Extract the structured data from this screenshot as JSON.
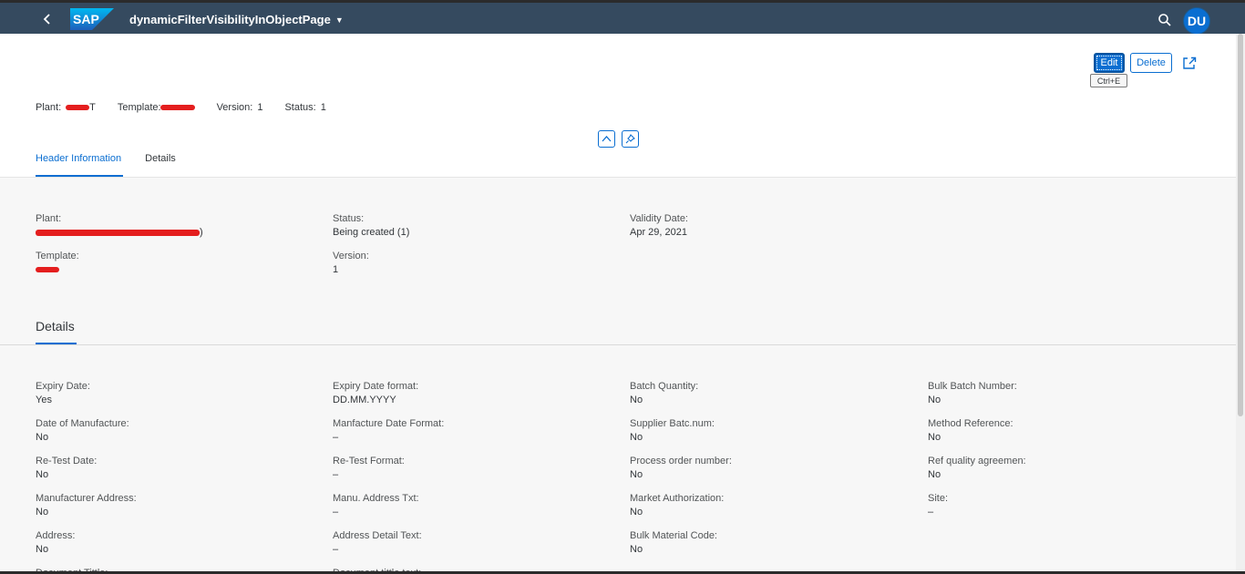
{
  "shell": {
    "title": "dynamicFilterVisibilityInObjectPage",
    "avatar_initials": "DU",
    "logo_text": "SAP"
  },
  "actions": {
    "edit_label": "Edit",
    "delete_label": "Delete",
    "edit_tooltip": "Ctrl+E"
  },
  "kpis": {
    "plant_label": "Plant:",
    "plant_suffix": "T",
    "template_label": "Template:",
    "version_label": "Version:",
    "version_value": "1",
    "status_label": "Status:",
    "status_value": "1"
  },
  "tabs": [
    {
      "label": "Header Information",
      "active": true
    },
    {
      "label": "Details",
      "active": false
    }
  ],
  "header_info": {
    "plant_label": "Plant:",
    "plant_suffix": ")",
    "template_label": "Template:",
    "status_label": "Status:",
    "status_value": "Being created (1)",
    "version_label": "Version:",
    "version_value": "1",
    "validity_label": "Validity Date:",
    "validity_value": "Apr 29, 2021"
  },
  "details": {
    "title": "Details",
    "columns": [
      [
        {
          "label": "Expiry Date:",
          "value": "Yes"
        },
        {
          "label": "Date of Manufacture:",
          "value": "No"
        },
        {
          "label": "Re-Test Date:",
          "value": "No"
        },
        {
          "label": "Manufacturer Address:",
          "value": "No"
        },
        {
          "label": "Address:",
          "value": "No"
        },
        {
          "label": "Document Tittle:",
          "value": ""
        }
      ],
      [
        {
          "label": "Expiry Date format:",
          "value": "DD.MM.YYYY"
        },
        {
          "label": "Manfacture Date Format:",
          "value": "–"
        },
        {
          "label": "Re-Test Format:",
          "value": "–"
        },
        {
          "label": "Manu. Address Txt:",
          "value": "–"
        },
        {
          "label": "Address Detail Text:",
          "value": "–"
        },
        {
          "label": "Document tittle text:",
          "value": ""
        }
      ],
      [
        {
          "label": "Batch Quantity:",
          "value": "No"
        },
        {
          "label": "Supplier Batc.num:",
          "value": "No"
        },
        {
          "label": "Process order number:",
          "value": "No"
        },
        {
          "label": "Market Authorization:",
          "value": "No"
        },
        {
          "label": "Bulk Material Code:",
          "value": "No"
        }
      ],
      [
        {
          "label": "Bulk Batch Number:",
          "value": "No"
        },
        {
          "label": "Method Reference:",
          "value": "No"
        },
        {
          "label": "Ref quality agreemen:",
          "value": "No"
        },
        {
          "label": "Site:",
          "value": "–"
        }
      ]
    ]
  },
  "colors": {
    "shell_bg": "#354a5f",
    "accent": "#0a6ed1",
    "redaction": "#e41e1e"
  },
  "icons": [
    "back-icon",
    "search-icon",
    "caret-down-icon",
    "share-icon",
    "collapse-header-icon",
    "pin-icon"
  ]
}
